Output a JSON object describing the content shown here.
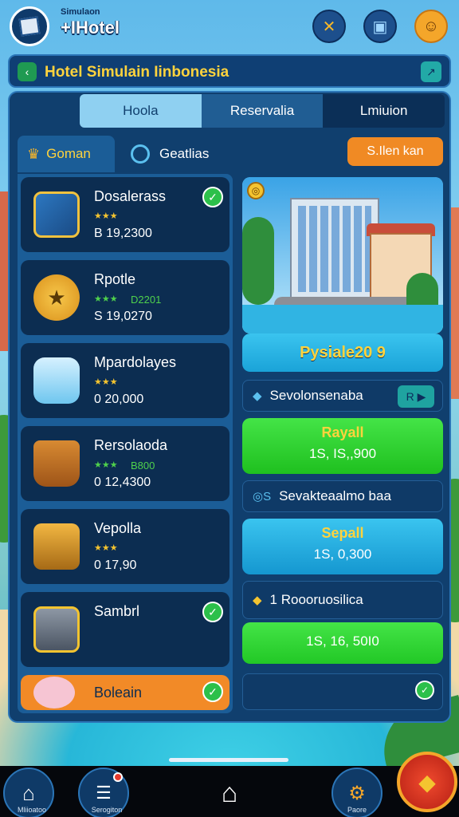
{
  "header": {
    "small_label": "Simulaon",
    "title": "+IHotel"
  },
  "titlebar": {
    "title": "Hotel Simulain Iinbonesia"
  },
  "tabs": [
    {
      "label": "Hoola"
    },
    {
      "label": "Reservalia"
    },
    {
      "label": "Lmiuion"
    }
  ],
  "subtabs": {
    "left": "Goman",
    "right": "Geatlias"
  },
  "sort_button": "S.Ilen kan",
  "items": [
    {
      "name": "Dosalerass",
      "stars": "★★★",
      "sub": "",
      "price": "B 19,2300",
      "checked": true
    },
    {
      "name": "Rpotle",
      "stars": "★★★",
      "sub": "D2201",
      "price": "S 19,0270",
      "checked": false
    },
    {
      "name": "Mpardolayes",
      "stars": "★★★",
      "sub": "",
      "price": "0 20,000",
      "checked": false
    },
    {
      "name": "Rersolaoda",
      "stars": "★★★",
      "sub": "B800",
      "price": "0 12,4300",
      "checked": false
    },
    {
      "name": "Vepolla",
      "stars": "★★★",
      "sub": "",
      "price": "0 17,90",
      "checked": false
    },
    {
      "name": "Sambrl",
      "stars": "",
      "sub": "",
      "price": "",
      "checked": true
    },
    {
      "name": "Boleain",
      "stars": "",
      "sub": "",
      "price": "",
      "checked": true
    }
  ],
  "preview": {
    "price_label": "Pysiale20 9"
  },
  "rows": [
    {
      "label": "Sevolonsenaba",
      "icon": "◆",
      "action": "R ▶"
    },
    {
      "label": "Sevakteaalmo baa",
      "icon": "◎S",
      "action": ""
    },
    {
      "label": "1 Roooruosilica",
      "icon": "◆",
      "action": ""
    },
    {
      "label": "",
      "icon": "",
      "action": "✓"
    }
  ],
  "offers": [
    {
      "label": "Rayall",
      "price": "1S, IS,,900"
    },
    {
      "label": "Sepall",
      "price": "1S, 0,300"
    },
    {
      "label": "",
      "price": "1S, 16, 50I0"
    }
  ],
  "nav": [
    {
      "label": "Mliioatoo"
    },
    {
      "label": "Serogiton"
    },
    {
      "label": ""
    },
    {
      "label": "Paore"
    },
    {
      "label": ""
    }
  ],
  "colors": {
    "panel": "#103f6e",
    "accent_gold": "#ffd33d",
    "accent_green": "#2cc04a",
    "accent_orange": "#f28a27"
  }
}
